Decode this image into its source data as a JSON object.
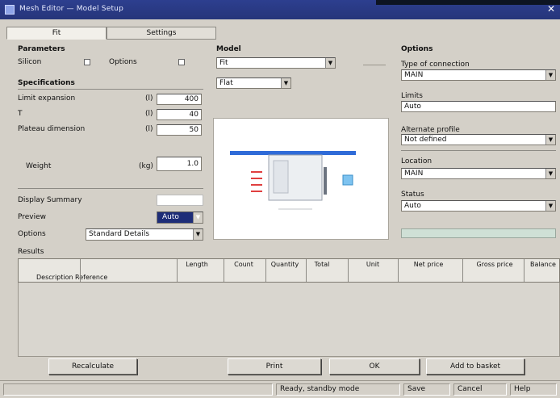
{
  "window": {
    "title": "Mesh Editor — Model Setup"
  },
  "tabs": [
    "Fit",
    "Settings"
  ],
  "parameters": {
    "header": "Parameters",
    "option_a": "Silicon",
    "option_b": "Options"
  },
  "geometry": {
    "header": "Specifications",
    "rows": [
      {
        "label": "Limit expansion",
        "unit": "(l)",
        "value": "400"
      },
      {
        "label": "T",
        "unit": "(l)",
        "value": "40"
      },
      {
        "label": "Plateau dimension",
        "unit": "(l)",
        "value": "50"
      }
    ],
    "weight": {
      "label": "Weight",
      "unit": "(kg)",
      "value": "1.0"
    }
  },
  "settings": {
    "label": "Display Summary",
    "row1": {
      "label": "Preview",
      "value": "Auto"
    },
    "row2": {
      "label": "Options",
      "value": "Standard Details"
    }
  },
  "model": {
    "header": "Model",
    "select1": "Fit",
    "select2": "Flat"
  },
  "options": {
    "header": "Options",
    "fields": [
      {
        "label": "Type of connection",
        "value": "MAIN"
      },
      {
        "label": "Limits",
        "value": "Auto"
      },
      {
        "label": "Alternate profile",
        "value": "Not defined"
      },
      {
        "label": "Location",
        "value": "MAIN"
      },
      {
        "label": "Status",
        "value": "Auto"
      }
    ],
    "progress": 0.0
  },
  "grid": {
    "title": "Results",
    "columns": [
      "Description",
      "Reference",
      "Length",
      "Count",
      "Quantity",
      "Total",
      "Unit",
      "Net price",
      "Gross price",
      "Balance"
    ]
  },
  "buttons": [
    "Recalculate",
    "Print",
    "OK",
    "Add to basket"
  ],
  "statusbar": {
    "left": "",
    "middle": "Ready, standby mode",
    "cells": [
      "Save",
      "Cancel",
      "Help"
    ]
  },
  "colors": {
    "titlebar": "#2a3a88",
    "chrome": "#d4d0c8",
    "selected": "#1e2d78",
    "accent_blue": "#2f6bd8"
  }
}
